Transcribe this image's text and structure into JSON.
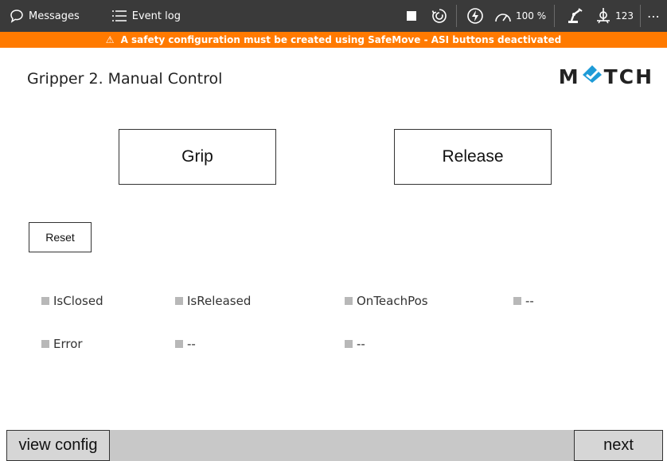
{
  "topbar": {
    "messages_label": "Messages",
    "eventlog_label": "Event log",
    "speed_value": "100 %",
    "tool_count": "123",
    "icons": [
      "chat-bubble-icon",
      "list-icon",
      "stop-square-icon",
      "cycle-icon",
      "lightning-icon",
      "speedometer-icon",
      "robot-icon",
      "coordinate-system-icon",
      "more-icon"
    ]
  },
  "warning": {
    "text": "A safety configuration must be created using SafeMove - ASI buttons deactivated",
    "color": "#ff7a00"
  },
  "page": {
    "title": "Gripper 2. Manual Control",
    "logo_text_left": "M",
    "logo_text_right": "TCH",
    "logo_accent_color": "#1e9bd7"
  },
  "buttons": {
    "grip": "Grip",
    "release": "Release",
    "reset": "Reset"
  },
  "status": {
    "row1": [
      "IsClosed",
      "IsReleased",
      "OnTeachPos",
      "--"
    ],
    "row2": [
      "Error",
      "--",
      "--"
    ],
    "indicator_color": "#b8b8b8"
  },
  "bottombar": {
    "view_config": "view config",
    "next": "next"
  }
}
